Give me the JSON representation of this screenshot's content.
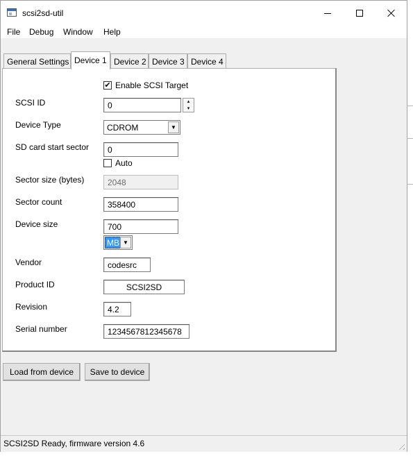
{
  "window": {
    "title": "scsi2sd-util",
    "icons": {
      "app": "app-window-icon",
      "minimize": "minimize-icon",
      "maximize": "maximize-icon",
      "close": "close-icon"
    }
  },
  "menu": [
    "File",
    "Debug",
    "Window",
    "Help"
  ],
  "tabs": [
    {
      "label": "General Settings",
      "active": false
    },
    {
      "label": "Device 1",
      "active": true
    },
    {
      "label": "Device 2",
      "active": false
    },
    {
      "label": "Device 3",
      "active": false
    },
    {
      "label": "Device 4",
      "active": false
    }
  ],
  "device": {
    "enable_label": "Enable SCSI Target",
    "enable_checked": "✔",
    "scsi_id_label": "SCSI ID",
    "scsi_id": "0",
    "device_type_label": "Device Type",
    "device_type": "CDROM",
    "sd_start_label": "SD card start sector",
    "sd_start": "0",
    "auto_label": "Auto",
    "sector_size_label": "Sector size (bytes)",
    "sector_size": "2048",
    "sector_count_label": "Sector count",
    "sector_count": "358400",
    "device_size_label": "Device size",
    "device_size": "700",
    "size_unit": "MB",
    "vendor_label": "Vendor",
    "vendor": "codesrc",
    "product_id_label": "Product ID",
    "product_id": "SCSI2SD",
    "revision_label": "Revision",
    "revision": "4.2",
    "serial_label": "Serial number",
    "serial": "1234567812345678"
  },
  "buttons": {
    "load": "Load from device",
    "save": "Save to device"
  },
  "status": "SCSI2SD Ready, firmware version 4.6",
  "colors": {
    "selection": "#3399ff",
    "panel": "#ffffff",
    "chrome": "#f0f0f0"
  }
}
